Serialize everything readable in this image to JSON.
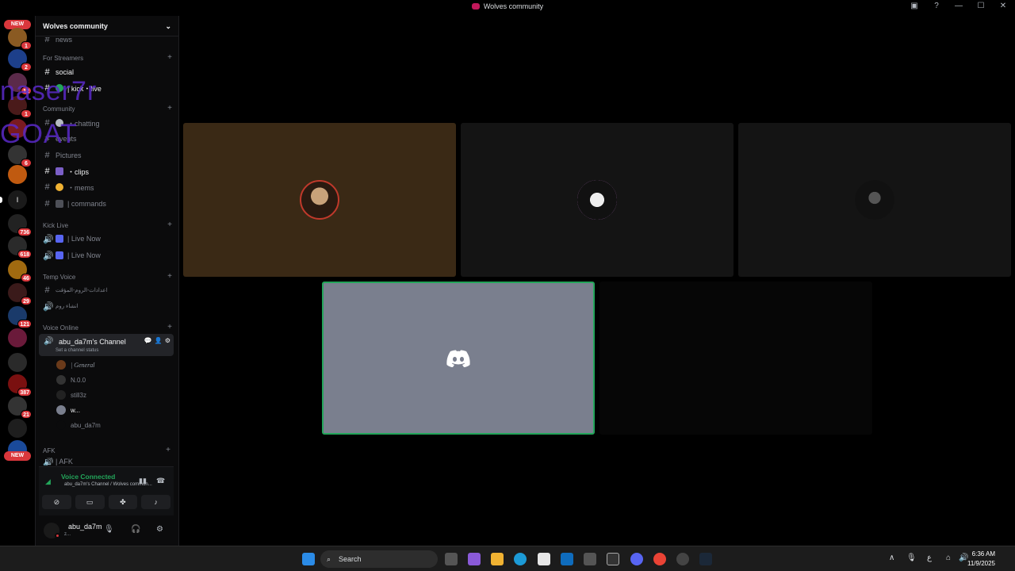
{
  "window": {
    "title": "Wolves community"
  },
  "rail": {
    "badges": [
      "NEW",
      "1",
      "2",
      "12",
      "1",
      "6",
      "736",
      "618",
      "46",
      "29",
      "121",
      "387",
      "21",
      "NEW"
    ]
  },
  "guild": {
    "name": "Wolves community"
  },
  "categories": {
    "streamers": "For Streamers",
    "community": "Community",
    "kick_live": "Kick Live",
    "temp_voice": "Temp Voice",
    "voice_online": "Voice Online",
    "afk": "AFK"
  },
  "channels": {
    "top_partial": "news",
    "social": "social",
    "kick": "| kick・live",
    "chatting": "・chatting",
    "events": "events",
    "pictures": "Pictures",
    "clips": "・clips",
    "mems": "・mems",
    "commands": "| commands",
    "live_now_1": "| Live Now",
    "live_now_2": "| Live Now",
    "temp_1": "اعدادات-الروم-المؤقت",
    "temp_2": "انشاء روم",
    "afk": "| AFK"
  },
  "active_voice": {
    "name": "abu_da7m's Channel",
    "status": "Set a channel status"
  },
  "members": [
    "| General",
    "N.0.0",
    "still3z",
    "w...",
    "abu_da7m"
  ],
  "overlay": {
    "line1": "naser7r",
    "line2": "GOAT"
  },
  "voice_panel": {
    "title": "Voice Connected",
    "sub": "abu_da7m's Channel / Wolves commun..."
  },
  "user": {
    "name": "abu_da7m",
    "status": "z..."
  },
  "taskbar": {
    "search": "Search",
    "time": "6:36 AM",
    "date": "11/9/2025",
    "lang": "ع"
  },
  "colors": {
    "voice_green": "#23a55a",
    "badge_red": "#da373c",
    "tile_brown": "#3a2915",
    "tile_dark": "#141414",
    "tile_grey": "#7a7f8e"
  }
}
